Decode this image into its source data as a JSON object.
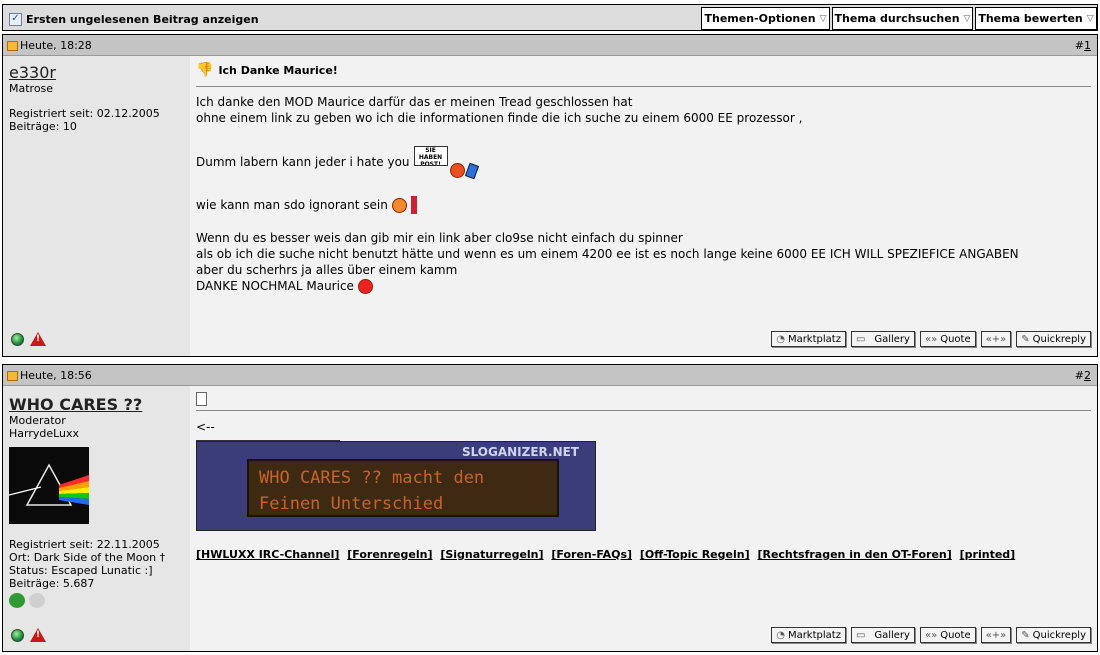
{
  "topbar": {
    "first_unread": "Ersten ungelesenen Beitrag anzeigen",
    "thread_options": "Themen-Optionen",
    "search_thread": "Thema durchsuchen",
    "rate_thread": "Thema bewerten"
  },
  "actions": {
    "marktplatz": "Marktplatz",
    "gallery": "Gallery",
    "quote": "Quote"
  },
  "post1": {
    "date": "Heute, 18:28",
    "number": "1",
    "username": "e330r",
    "rank": "Matrose",
    "registered": "Registriert seit: 02.12.2005",
    "posts": "Beiträge: 10",
    "title": "Ich Danke Maurice!",
    "body": {
      "l1": "Ich danke den MOD Maurice darfür das er meinen Tread geschlossen hat",
      "l2": "ohne einem link zu geben wo ich die informationen finde die ich suche zu einem 6000 EE prozessor ,",
      "l3": "Dumm labern kann jeder i hate you",
      "sign_text": "SIE HABEN POST!",
      "l4": "wie kann man sdo ignorant sein",
      "l5": "Wenn du es besser weis dan gib mir ein link aber clo9se nicht einfach du spinner",
      "l6": "als ob ich die suche nicht benutzt hätte und wenn es um einem 4200 ee ist es noch lange keine 6000 EE ICH WILL SPEZIEFICE ANGABEN",
      "l7": "aber du scherhrs ja alles über einem kamm",
      "l8": "DANKE NOCHMAL Maurice"
    },
    "quickreply": "Quickreply"
  },
  "post2": {
    "date": "Heute, 18:56",
    "number": "2",
    "username": "WHO CARES ??",
    "rank": "Moderator",
    "title_sub": "HarrydeLuxx",
    "registered": "Registriert seit: 22.11.2005",
    "location": "Ort: Dark Side of the Moon †",
    "status": "Status: Escaped Lunatic :]",
    "posts": "Beiträge: 5.687",
    "body_text": "<--",
    "banner": {
      "brand": "SLOGANIZER.NET",
      "line1": "WHO CARES ?? macht den",
      "line2": "Feinen Unterschied"
    },
    "links": [
      "[HWLUXX IRC-Channel]",
      "[Forenregeln]",
      "[Signaturregeln]",
      "[Foren-FAQs]",
      "[Off-Topic Regeln]",
      "[Rechtsfragen in den OT-Foren]",
      "[printed]"
    ],
    "quickreply": "Quickreply"
  }
}
